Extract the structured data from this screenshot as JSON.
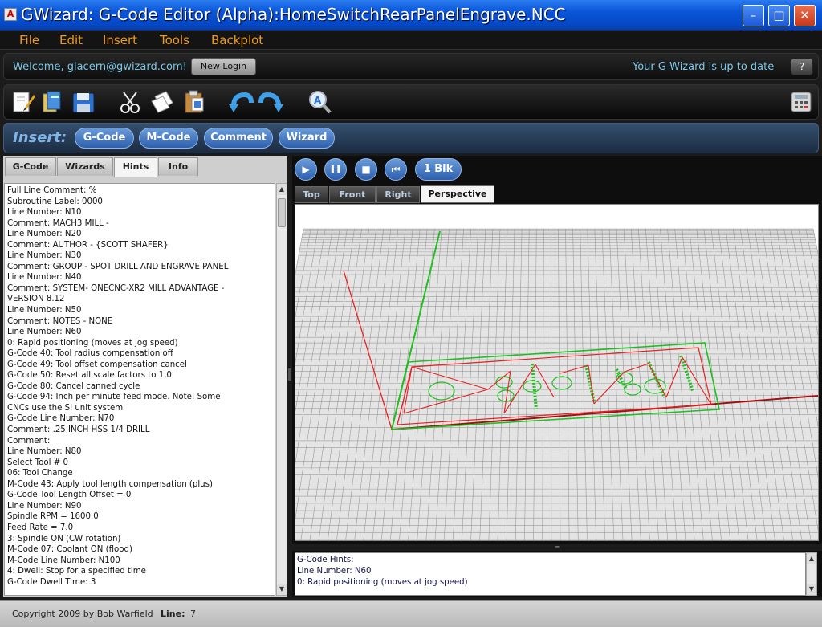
{
  "window": {
    "title": "GWizard: G-Code Editor (Alpha):HomeSwitchRearPanelEngrave.NCC",
    "minimize": "–",
    "maximize": "□",
    "close": "✕"
  },
  "menu": [
    "File",
    "Edit",
    "Insert",
    "Tools",
    "Backplot"
  ],
  "user": {
    "welcome": "Welcome, glacern@gwizard.com!",
    "new_login": "New Login",
    "status": "Your G-Wizard is up to date",
    "help": "?"
  },
  "toolbar": {
    "icons": [
      "new-document-icon",
      "open-icon",
      "save-icon",
      "cut-icon",
      "copy-icon",
      "paste-icon",
      "undo-icon",
      "redo-icon",
      "find-icon",
      "calculator-icon"
    ]
  },
  "insert": {
    "label": "Insert:",
    "buttons": [
      "G-Code",
      "M-Code",
      "Comment",
      "Wizard"
    ]
  },
  "left_tabs": [
    "G-Code",
    "Wizards",
    "Hints",
    "Info"
  ],
  "active_left_tab": "Hints",
  "hints": [
    "Full Line Comment: %",
    "  Subroutine Label: 0000",
    "Line Number: N10",
    "  Comment: MACH3 MILL -",
    "Line Number: N20",
    "  Comment: AUTHOR - {SCOTT SHAFER}",
    "Line Number: N30",
    "  Comment: GROUP - SPOT DRILL AND ENGRAVE PANEL",
    "Line Number: N40",
    "  Comment: SYSTEM- ONECNC-XR2 MILL ADVANTAGE -",
    "VERSION 8.12",
    "Line Number: N50",
    "  Comment: NOTES - NONE",
    "Line Number: N60",
    "0: Rapid positioning (moves at jog speed)",
    "  G-Code 40: Tool radius compensation off",
    "  G-Code 49: Tool offset compensation cancel",
    "  G-Code 50: Reset all scale factors to 1.0",
    "  G-Code 80: Cancel canned cycle",
    "  G-Code 94: Inch per minute feed mode. Note: Some",
    "CNCs use the SI unit system",
    "  G-Code Line Number: N70",
    "  Comment: .25 INCH HSS 1/4 DRILL",
    "  Comment:",
    "Line Number: N80",
    "  Select Tool # 0",
    "06: Tool Change",
    "  M-Code 43: Apply tool length compensation (plus)",
    "  G-Code   Tool Length Offset = 0",
    "Line Number: N90",
    "  Spindle RPM = 1600.0",
    "  Feed Rate = 7.0",
    "3: Spindle ON (CW rotation)",
    "  M-Code 07: Coolant ON (flood)",
    "  M-Code Line Number: N100",
    "4: Dwell: Stop for a specified time",
    "  G-Code   Dwell Time: 3"
  ],
  "playback": {
    "play": "▶",
    "pause": "❚❚",
    "stop": "■",
    "rewind": "⏮",
    "block": "1 Blk"
  },
  "view_tabs": [
    "Top",
    "Front",
    "Right",
    "Perspective"
  ],
  "active_view_tab": "Perspective",
  "hint_panel": [
    "G-Code Hints:",
    "Line Number: N60",
    "0: Rapid positioning (moves at jog speed)"
  ],
  "footer": {
    "copyright": "Copyright 2009 by Bob Warfield",
    "line_label": "Line:",
    "line_value": "7"
  },
  "colors": {
    "menu_text": "#f09a1e",
    "accent_blue": "#2d5fae",
    "status_text": "#7cc7e8",
    "rapid_path": "#e82020",
    "feed_path": "#1fbf1f"
  }
}
